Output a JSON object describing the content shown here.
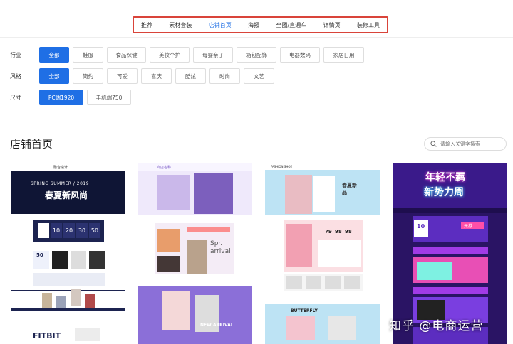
{
  "top_nav": {
    "tabs": [
      {
        "label": "推荐",
        "active": false
      },
      {
        "label": "素材套装",
        "active": false
      },
      {
        "label": "店铺首页",
        "active": true
      },
      {
        "label": "海报",
        "active": false
      },
      {
        "label": "全图/直通车",
        "active": false
      },
      {
        "label": "详情页",
        "active": false
      },
      {
        "label": "装修工具",
        "active": false
      }
    ]
  },
  "filters": {
    "industry": {
      "label": "行业",
      "options": [
        "全部",
        "鞋服",
        "食品保健",
        "美妆个护",
        "母婴亲子",
        "箱包配饰",
        "电器数码",
        "家居日用"
      ]
    },
    "style": {
      "label": "风格",
      "options": [
        "全部",
        "简约",
        "可爱",
        "喜庆",
        "酷炫",
        "时尚",
        "文艺"
      ]
    },
    "size": {
      "label": "尺寸",
      "options": [
        "PC端1920",
        "手机端750"
      ]
    }
  },
  "section": {
    "title": "店铺首页",
    "search_placeholder": "请输入关键字搜索"
  },
  "templates": {
    "t1": {
      "brand": "融合设计",
      "banner_text": "SPRING SUMMER / 2019",
      "banner_title": "春夏新风尚",
      "countdown": [
        "10",
        "20",
        "30",
        "50"
      ],
      "coupon_value": "50",
      "footer_brand": "FITBIT"
    },
    "t2": {
      "brand": "商店名称",
      "promo_text": "Spr. arrival",
      "new_arrival": "NEW ARRIVAL"
    },
    "t3": {
      "brand": "FASHION SHOE",
      "badge": "春夏新品",
      "prices": [
        "79",
        "98",
        "98"
      ],
      "banner": "BUTTERFLY"
    },
    "t4": {
      "banner_title": "年轻不羁",
      "banner_subtitle": "新势力周",
      "coupon": "10",
      "badge": "元券"
    }
  },
  "watermark": "知乎 @电商运营",
  "colors": {
    "accent": "#1f6fe5",
    "nav_highlight_border": "#d9443a"
  }
}
